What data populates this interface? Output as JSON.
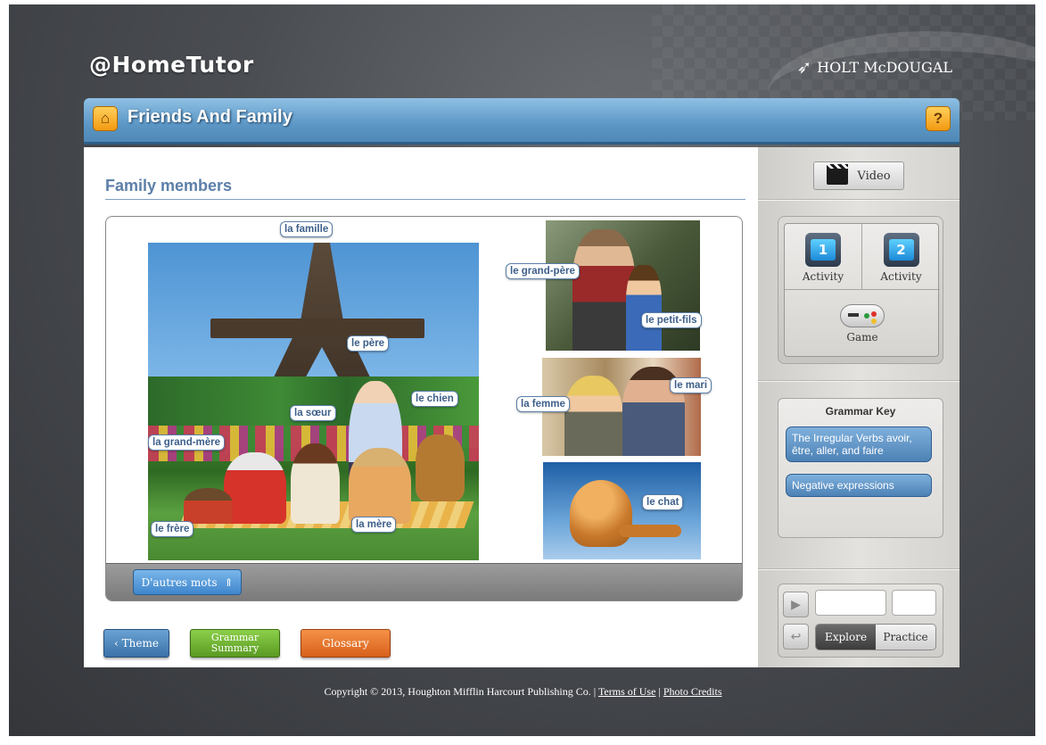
{
  "brand": {
    "logo": "@HomeTutor",
    "publisher": "HOLT McDOUGAL"
  },
  "header": {
    "title": "Friends And Family",
    "home_icon": "home-icon",
    "help_label": "?"
  },
  "main": {
    "section_title": "Family members",
    "more_words_label": "D'autres mots",
    "labels": {
      "famille": "la famille",
      "pere": "le père",
      "chien": "le chien",
      "soeur": "la sœur",
      "grand_mere": "la grand-mère",
      "frere": "le frère",
      "mere": "la mère",
      "grand_pere": "le grand-père",
      "petit_fils": "le petit-fils",
      "femme": "la femme",
      "mari": "le mari",
      "chat": "le chat"
    },
    "buttons": {
      "theme": "Theme",
      "grammar_line1": "Grammar",
      "grammar_line2": "Summary",
      "glossary": "Glossary"
    }
  },
  "sidebar": {
    "video_label": "Video",
    "activities": [
      {
        "number": "1",
        "label": "Activity"
      },
      {
        "number": "2",
        "label": "Activity"
      }
    ],
    "game_label": "Game",
    "grammar_key": {
      "title": "Grammar Key",
      "items": [
        "The Irregular Verbs avoir, être, aller, and faire",
        "Negative expressions"
      ]
    },
    "modes": {
      "explore": "Explore",
      "practice": "Practice",
      "active": "Explore"
    }
  },
  "footer": {
    "copyright": "Copyright © 2013, Houghton Mifflin Harcourt Publishing Co. |",
    "terms": "Terms of Use",
    "separator": "|",
    "credits": "Photo Credits"
  },
  "colors": {
    "title_bar": "#5c97c6",
    "accent_blue": "#3d5f8a",
    "theme_button": "#3a72a8",
    "grammar_button": "#5a9a22",
    "glossary_button": "#d8601a"
  }
}
